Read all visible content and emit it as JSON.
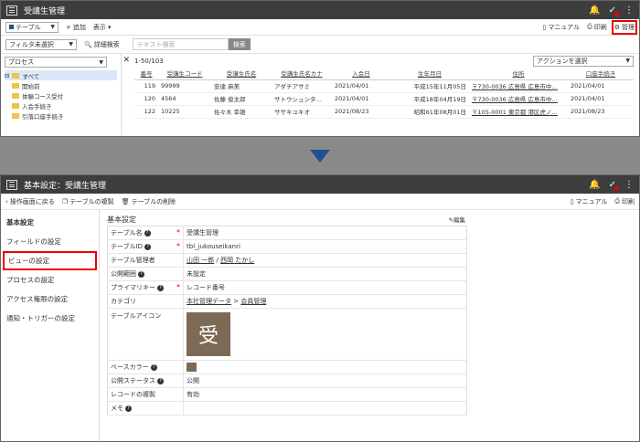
{
  "top": {
    "title": "受講生管理",
    "view_select": "テーブル",
    "add_label": "追加",
    "display_label": "表示",
    "manual_label": "マニュアル",
    "print_label": "印刷",
    "admin_label": "管理",
    "filter_select": "フィルタ未選択",
    "detail_search": "詳細検索",
    "search_placeholder": "テキスト検索",
    "search_button": "検索",
    "process_select": "プロセス",
    "tree": [
      "すべて",
      "開始前",
      "体験コース受付",
      "入会手続き",
      "引落口座手続き"
    ],
    "record_count": "1-50/103",
    "action_select": "アクションを選択",
    "columns": [
      "番号",
      "受講生コード",
      "受講生氏名",
      "受講生氏名カナ",
      "入会日",
      "生年月日",
      "住所",
      "口座手続き"
    ],
    "rows": [
      [
        "119",
        "99999",
        "安達 麻美",
        "アダチアサミ",
        "2021/04/01",
        "平成15年11月05日",
        "〒730-0036 広島県 広島市中…",
        "2021/04/01"
      ],
      [
        "120",
        "4564",
        "佐藤 俊太郎",
        "サトウシュンタ…",
        "2021/04/01",
        "平成18年04月19日",
        "〒730-0036 広島県 広島市中…",
        "2021/04/01"
      ],
      [
        "122",
        "10225",
        "佐々木 幸雄",
        "ササキユキオ",
        "2021/08/23",
        "昭和61年08月01日",
        "〒105-0001 東京都 港区虎ノ…",
        "2021/08/23"
      ]
    ]
  },
  "bottom": {
    "title": "基本設定：受講生管理",
    "back_label": "操作画面に戻る",
    "copy_label": "テーブルの複製",
    "delete_label": "テーブルの削除",
    "manual_label": "マニュアル",
    "print_label": "印刷",
    "nav": [
      "基本設定",
      "フィールドの設定",
      "ビューの設定",
      "プロセスの設定",
      "アクセス権限の設定",
      "通知・トリガーの設定"
    ],
    "section_title": "基本設定",
    "edit_label": "編集",
    "fields": {
      "table_name_k": "テーブル名",
      "table_name_v": "受講生管理",
      "table_id_k": "テーブルID",
      "table_id_v": "tbl_jukouseikanri",
      "admin_k": "テーブル管理者",
      "admin_v1": "山田 一郎",
      "admin_sep": " / ",
      "admin_v2": "西岡 たかし",
      "scope_k": "公開範囲",
      "scope_v": "未設定",
      "pkey_k": "プライマリキー",
      "pkey_v": "レコード番号",
      "cat_k": "カテゴリ",
      "cat_v1": "本社管理データ",
      "cat_sep": " > ",
      "cat_v2": "会員管理",
      "icon_k": "テーブルアイコン",
      "icon_char": "受",
      "basecolor_k": "ベースカラー",
      "status_k": "公開ステータス",
      "status_v": "公開",
      "dup_k": "レコードの複製",
      "dup_v": "有効",
      "memo_k": "メモ"
    }
  },
  "colors": {
    "header": "#3d3d3d",
    "highlight": "#e00000",
    "icon_bg": "#7d6a56",
    "arrow": "#1e4f8f"
  }
}
